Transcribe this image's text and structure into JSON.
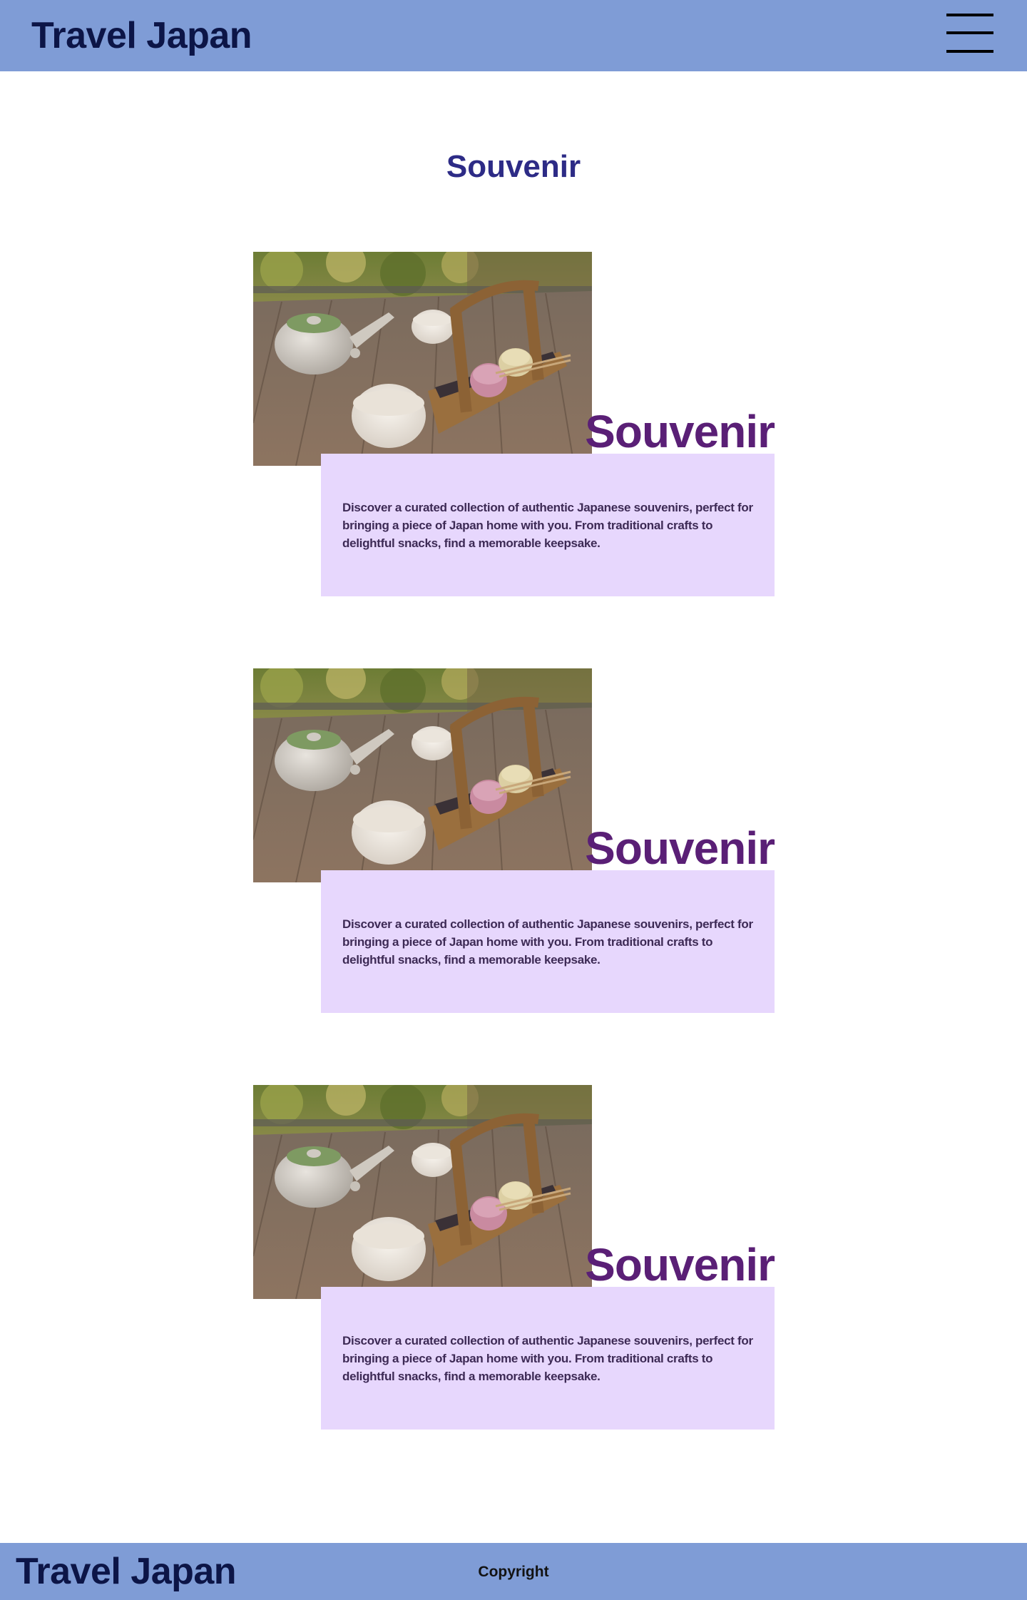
{
  "header": {
    "brand": "Travel Japan",
    "menu_icon": "hamburger-menu-icon"
  },
  "main": {
    "title": "Souvenir",
    "cards": [
      {
        "image": "tea-set-photo",
        "title": "Souvenir",
        "text": "Discover a curated collection of authentic Japanese souvenirs, perfect for bringing a piece of Japan home with you. From traditional crafts to delightful snacks, find a memorable keepsake."
      },
      {
        "image": "tea-set-photo",
        "title": "Souvenir",
        "text": "Discover a curated collection of authentic Japanese souvenirs, perfect for bringing a piece of Japan home with you. From traditional crafts to delightful snacks, find a memorable keepsake."
      },
      {
        "image": "tea-set-photo",
        "title": "Souvenir",
        "text": "Discover a curated collection of authentic Japanese souvenirs, perfect for bringing a piece of Japan home with you. From traditional crafts to delightful snacks, find a memorable keepsake."
      }
    ]
  },
  "footer": {
    "brand": "Travel Japan",
    "copyright": "Copyright"
  },
  "colors": {
    "header_bg": "#7f9cd6",
    "brand_text": "#0c1547",
    "page_title": "#2d2b86",
    "card_title": "#5a1f76",
    "card_box_bg": "#e7d7fd",
    "card_text": "#3d2a55"
  }
}
